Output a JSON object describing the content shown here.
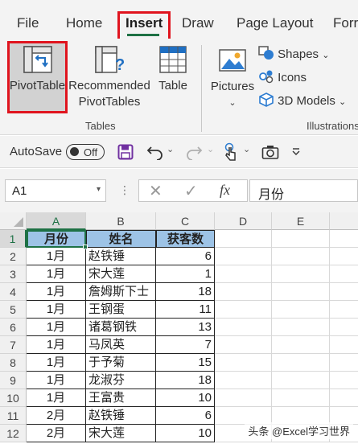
{
  "ribbon_tabs": [
    {
      "label": "File"
    },
    {
      "label": "Home"
    },
    {
      "label": "Insert"
    },
    {
      "label": "Draw"
    },
    {
      "label": "Page Layout"
    },
    {
      "label": "Forr"
    }
  ],
  "insert_ribbon": {
    "pivottable_label": "PivotTable",
    "recommended_line1": "Recommended",
    "recommended_line2": "PivotTables",
    "table_label": "Table",
    "tables_group_label": "Tables",
    "pictures_label": "Pictures",
    "shapes_label": "Shapes",
    "icons_label": "Icons",
    "models_label": "3D Models",
    "illustrations_group_label": "Illustrations"
  },
  "quick_access": {
    "autosave_label": "AutoSave",
    "autosave_state": "Off"
  },
  "formula_bar": {
    "name_box": "A1",
    "fx_label": "fx",
    "formula_value": "月份"
  },
  "sheet": {
    "columns": [
      "A",
      "B",
      "C",
      "D",
      "E"
    ],
    "headers": [
      "月份",
      "姓名",
      "获客数"
    ],
    "rows": [
      {
        "num": "1"
      },
      {
        "num": "2",
        "month": "1月",
        "name": "赵铁锤",
        "count": "6"
      },
      {
        "num": "3",
        "month": "1月",
        "name": "宋大莲",
        "count": "1"
      },
      {
        "num": "4",
        "month": "1月",
        "name": "詹姆斯下士",
        "count": "18"
      },
      {
        "num": "5",
        "month": "1月",
        "name": "王钢蛋",
        "count": "11"
      },
      {
        "num": "6",
        "month": "1月",
        "name": "诸葛钢铁",
        "count": "13"
      },
      {
        "num": "7",
        "month": "1月",
        "name": "马凤英",
        "count": "7"
      },
      {
        "num": "8",
        "month": "1月",
        "name": "于予菊",
        "count": "15"
      },
      {
        "num": "9",
        "month": "1月",
        "name": "龙淑芬",
        "count": "18"
      },
      {
        "num": "10",
        "month": "1月",
        "name": "王富贵",
        "count": "10"
      },
      {
        "num": "11",
        "month": "2月",
        "name": "赵铁锤",
        "count": "6"
      },
      {
        "num": "12",
        "month": "2月",
        "name": "宋大莲",
        "count": "10"
      }
    ]
  },
  "watermark": "头条 @Excel学习世界",
  "colors": {
    "excel_green": "#1e7145",
    "highlight_red": "#e0141e",
    "header_fill": "#9dc3e6",
    "qat_purple": "#7030a0"
  }
}
